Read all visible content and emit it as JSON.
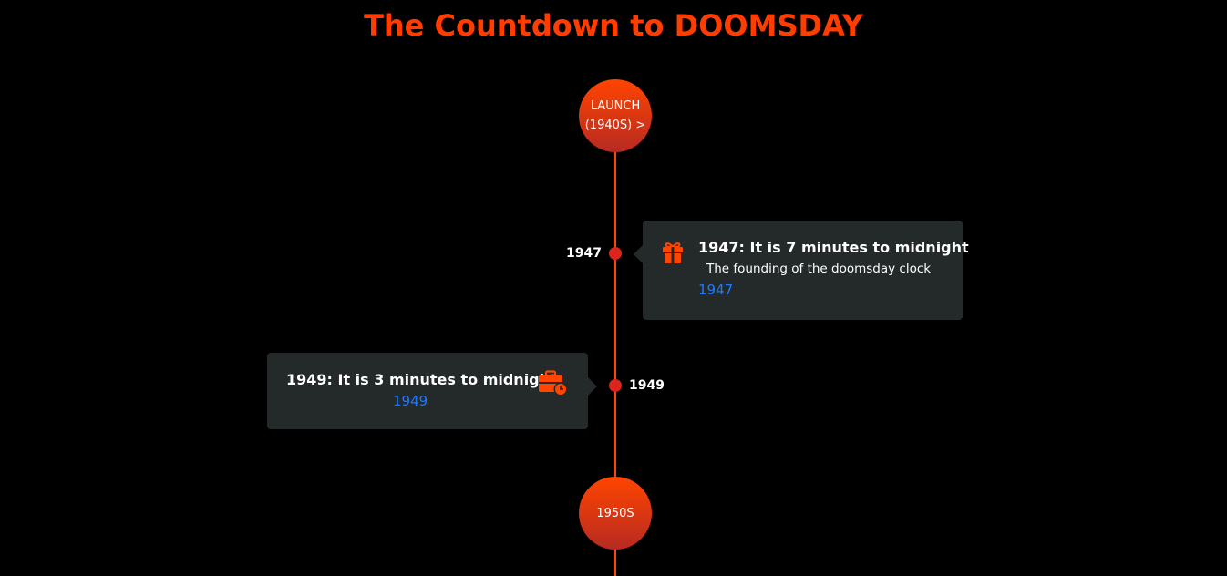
{
  "page": {
    "title": "The Countdown to DOOMSDAY"
  },
  "colors": {
    "background": "#000000",
    "accent": "#ff3d00",
    "timeline": "#ff4500",
    "card_background": "#242a2a",
    "link": "#1e7bff",
    "text": "#ffffff"
  },
  "timeline": {
    "eras": [
      {
        "label_line1": "LAUNCH",
        "label_line2": "(1940S) >"
      },
      {
        "label_line1": "1950S"
      }
    ],
    "events": [
      {
        "year": "1947",
        "title": "1947: It is 7 minutes to midnight",
        "description": "The founding of the doomsday clock",
        "link": "1947",
        "icon": "gift-icon"
      },
      {
        "year": "1949",
        "title": "1949: It is 3 minutes to midnight",
        "link": "1949",
        "icon": "briefcase-clock-icon"
      }
    ]
  }
}
